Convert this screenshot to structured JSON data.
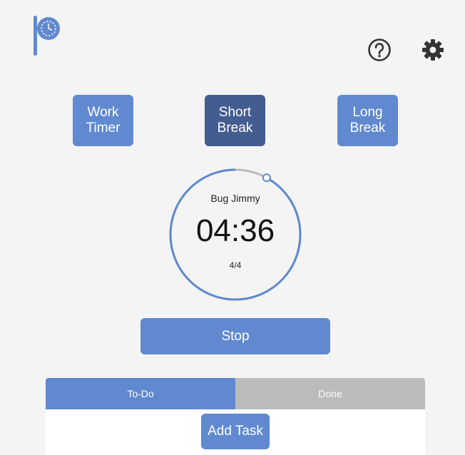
{
  "header": {
    "logo_icon": "pomodoro-flag-logo",
    "help_icon": "question-circle-icon",
    "settings_icon": "gear-icon"
  },
  "modes": {
    "work": {
      "line1": "Work",
      "line2": "Timer",
      "active": false
    },
    "short": {
      "line1": "Short",
      "line2": "Break",
      "active": true
    },
    "long": {
      "line1": "Long",
      "line2": "Break",
      "active": false
    }
  },
  "timer": {
    "task_name": "Bug Jimmy",
    "time": "04:36",
    "count": "4/4",
    "progress_fraction": 0.92
  },
  "controls": {
    "stop_label": "Stop"
  },
  "tasks": {
    "tabs": [
      {
        "label": "To-Do",
        "active": true
      },
      {
        "label": "Done",
        "active": false
      }
    ],
    "add_task_label": "Add Task"
  },
  "colors": {
    "accent": "#6089cf",
    "accent_active": "#445d90",
    "inactive_tab": "#bbbbbb",
    "background": "#f4f4f4"
  }
}
